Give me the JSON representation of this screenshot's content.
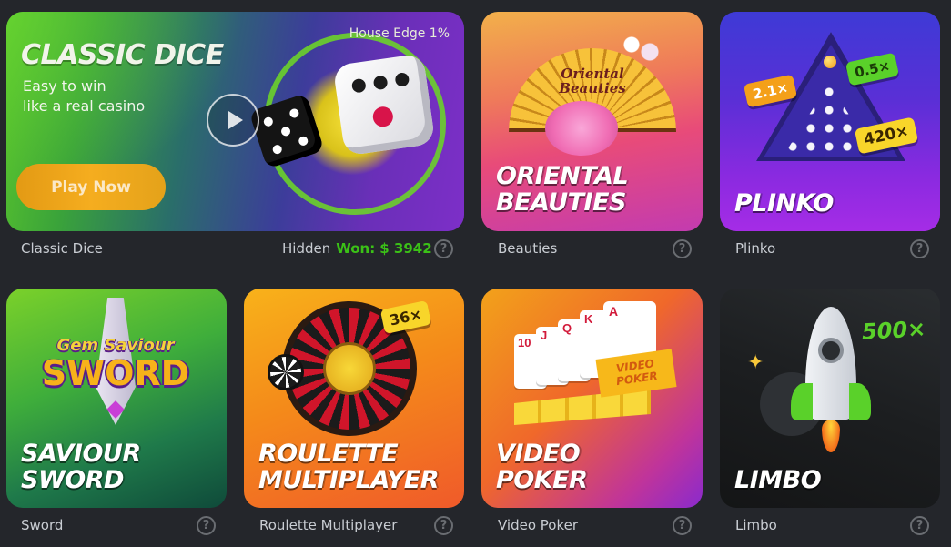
{
  "featured": {
    "title": "CLASSIC DICE",
    "subtitle_1": "Easy to win",
    "subtitle_2": "like a real casino",
    "house_edge": "House Edge 1%",
    "play_label": "Play Now",
    "caption": "Classic Dice",
    "player": "Hidden",
    "won_label": "Won:",
    "won_amount": "$ 3942"
  },
  "games": [
    {
      "title_1": "ORIENTAL",
      "title_2": "BEAUTIES",
      "caption": "Beauties",
      "logo_1": "Oriental",
      "logo_2": "Beauties"
    },
    {
      "title_1": "PLINKO",
      "caption": "Plinko",
      "mult_a": "2.1×",
      "mult_b": "0.5×",
      "mult_c": "420×"
    },
    {
      "title_1": "SAVIOUR",
      "title_2": "SWORD",
      "caption": "Sword",
      "logo_1": "Gem Saviour",
      "logo_2": "SWORD"
    },
    {
      "title_1": "ROULETTE",
      "title_2": "MULTIPLAYER",
      "caption": "Roulette Multiplayer",
      "mult": "36×"
    },
    {
      "title_1": "VIDEO",
      "title_2": "POKER",
      "caption": "Video Poker",
      "ribbon_1": "VIDEO",
      "ribbon_2": "POKER",
      "cards": [
        "10",
        "J",
        "Q",
        "K",
        "A"
      ]
    },
    {
      "title_1": "LIMBO",
      "caption": "Limbo",
      "mult": "500×"
    }
  ],
  "help_glyph": "?",
  "colors": {
    "background": "#24262b",
    "won": "#3bc117",
    "caption": "#c9cdd3",
    "play_button": "#f5a41b"
  }
}
